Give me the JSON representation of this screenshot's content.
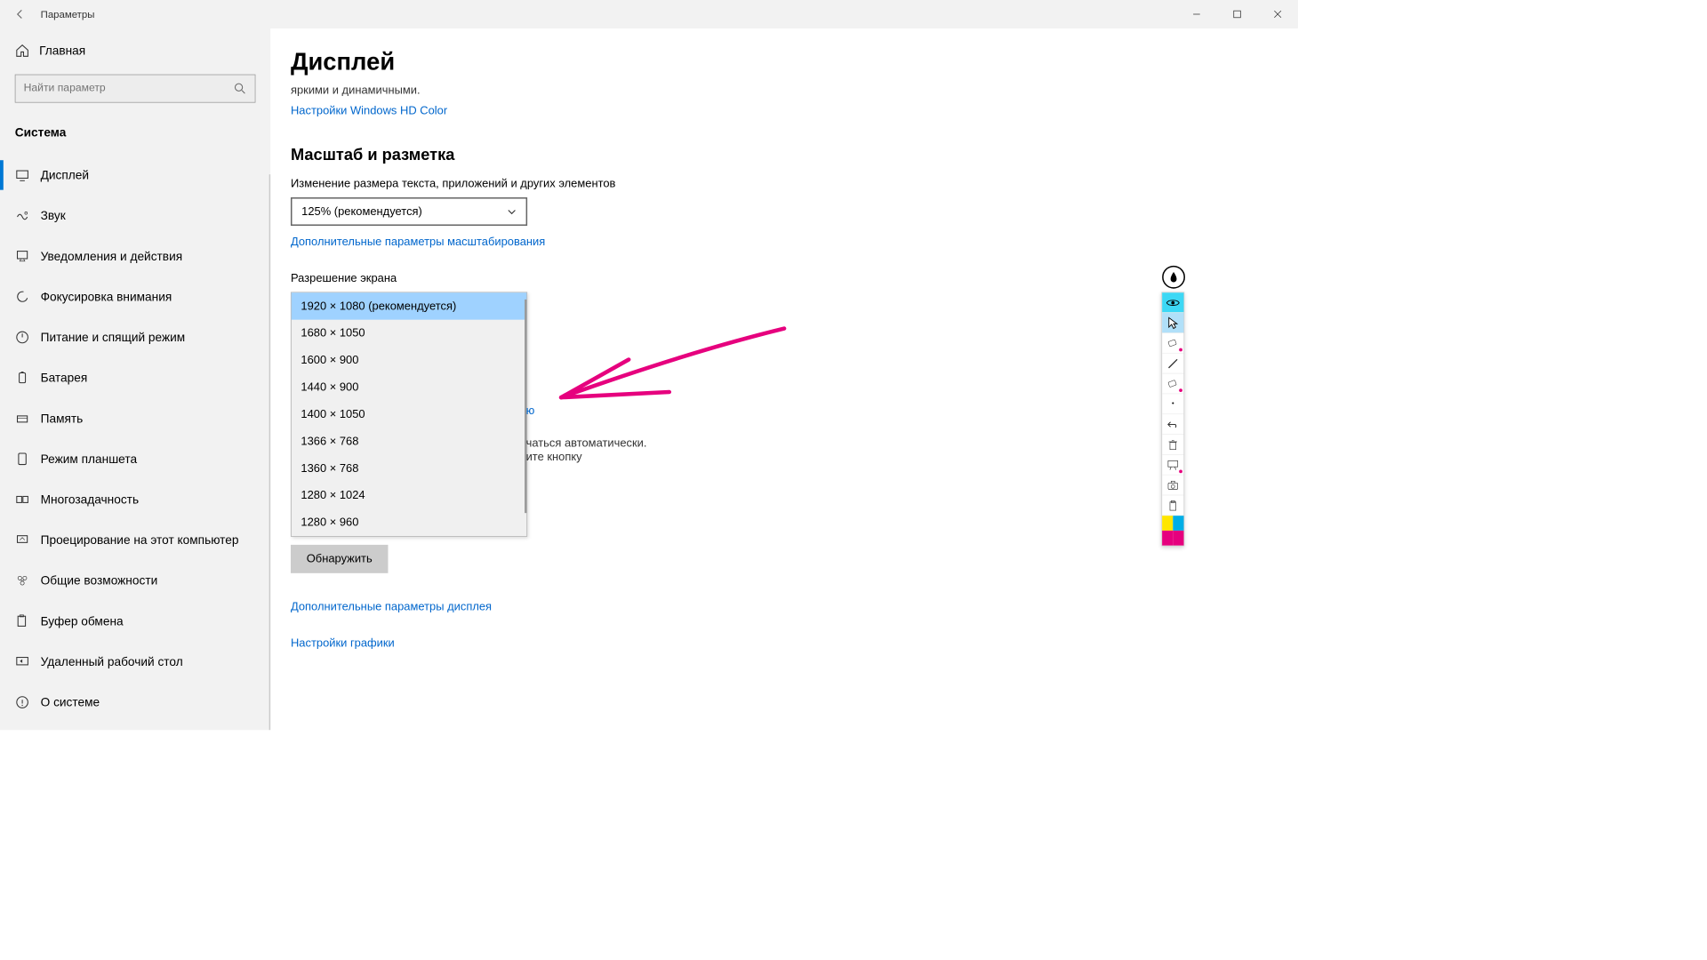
{
  "titlebar": {
    "title": "Параметры"
  },
  "sidebar": {
    "home": "Главная",
    "search_placeholder": "Найти параметр",
    "system": "Система",
    "items": [
      {
        "label": "Дисплей",
        "active": true
      },
      {
        "label": "Звук"
      },
      {
        "label": "Уведомления и действия"
      },
      {
        "label": "Фокусировка внимания"
      },
      {
        "label": "Питание и спящий режим"
      },
      {
        "label": "Батарея"
      },
      {
        "label": "Память"
      },
      {
        "label": "Режим планшета"
      },
      {
        "label": "Многозадачность"
      },
      {
        "label": "Проецирование на этот компьютер"
      },
      {
        "label": "Общие возможности"
      },
      {
        "label": "Буфер обмена"
      },
      {
        "label": "Удаленный рабочий стол"
      },
      {
        "label": "О системе"
      }
    ]
  },
  "main": {
    "heading": "Дисплей",
    "hdr_sub": "яркими и динамичными.",
    "hdr_link": "Настройки Windows HD Color",
    "scale_heading": "Масштаб и разметка",
    "scale_label": "Изменение размера текста, приложений и других элементов",
    "scale_value": "125% (рекомендуется)",
    "scale_advanced": "Дополнительные параметры масштабирования",
    "resolution_label": "Разрешение экрана",
    "resolution_options": [
      "1920 × 1080 (рекомендуется)",
      "1680 × 1050",
      "1600 × 900",
      "1440 × 900",
      "1400 × 1050",
      "1366 × 768",
      "1360 × 768",
      "1280 × 1024",
      "1280 × 960"
    ],
    "behind_link_partial": "ю",
    "behind_text1": "чаться автоматически.",
    "behind_text2": "ите кнопку",
    "detect_btn": "Обнаружить",
    "adv_display": "Дополнительные параметры дисплея",
    "graphics": "Настройки графики"
  },
  "annotation": {
    "arrow_color": "#e6007e"
  }
}
